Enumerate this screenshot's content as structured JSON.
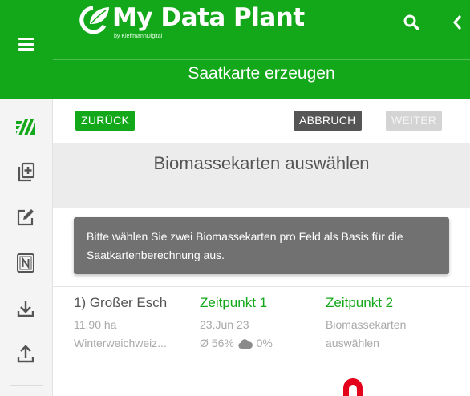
{
  "header": {
    "app_name": "My Data Plant",
    "app_sub": "by KleffmannDigital",
    "page_title": "Saatkarte erzeugen"
  },
  "toolbar": {
    "back_label": "ZURÜCK",
    "cancel_label": "ABBRUCH",
    "next_label": "WEITER"
  },
  "section": {
    "title": "Biomassekarten auswählen"
  },
  "info": {
    "text": "Bitte wählen Sie zwei Biomassekarten pro Feld als Basis für die Saatkartenberechnung aus."
  },
  "field": {
    "name": "1) Großer Esch",
    "area": "11.90 ha",
    "crop": "Winterweichweiz...",
    "t1_label": "Zeitpunkt 1",
    "t1_date": "23.Jun 23",
    "t1_avg": "Ø 56%",
    "t1_cloud": "0%",
    "t2_label": "Zeitpunkt 2",
    "t2_line1": "Biomassekarten",
    "t2_line2": "auswählen"
  },
  "colors": {
    "brand_green": "#13a81a",
    "info_bg": "#717171",
    "disabled": "#d4d4d4",
    "alert_red": "#e4001b"
  },
  "icons": [
    "menu-icon",
    "field-map-icon",
    "add-document-icon",
    "edit-icon",
    "n-fertilizer-icon",
    "download-icon",
    "upload-icon",
    "search-icon",
    "chevron-left-icon",
    "cloud-icon"
  ]
}
